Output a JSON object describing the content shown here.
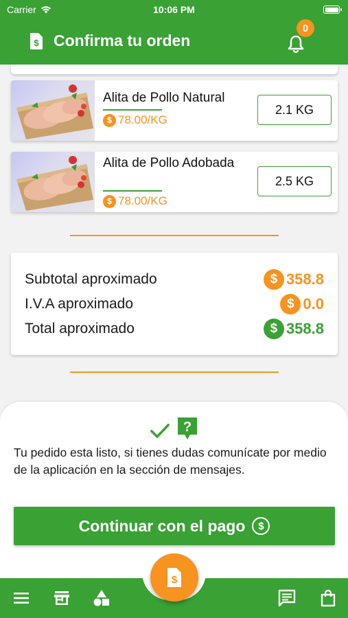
{
  "status_bar": {
    "carrier": "Carrier",
    "time": "10:06 PM"
  },
  "header": {
    "title": "Confirma tu orden",
    "notification_count": "0"
  },
  "products": [
    {
      "name": "Alita de Pollo Natural",
      "price": "78.00/KG",
      "quantity": "2.1 KG"
    },
    {
      "name": "Alita de Pollo Adobada",
      "price": "78.00/KG",
      "quantity": "2.5 KG"
    }
  ],
  "totals": {
    "subtotal_label": "Subtotal aproximado",
    "subtotal_value": "358.8",
    "iva_label": "I.V.A aproximado",
    "iva_value": "0.0",
    "total_label": "Total aproximado",
    "total_value": "358.8"
  },
  "sheet": {
    "message": "Tu pedido esta listo, si tienes dudas comunícate por medio de la aplicación en la sección de mensajes.",
    "button_label": "Continuar con el pago"
  },
  "icons": {
    "currency_symbol": "$",
    "help_symbol": "?",
    "check_symbol": "✓"
  },
  "colors": {
    "primary_green": "#3aa135",
    "accent_orange": "#f7931e"
  }
}
